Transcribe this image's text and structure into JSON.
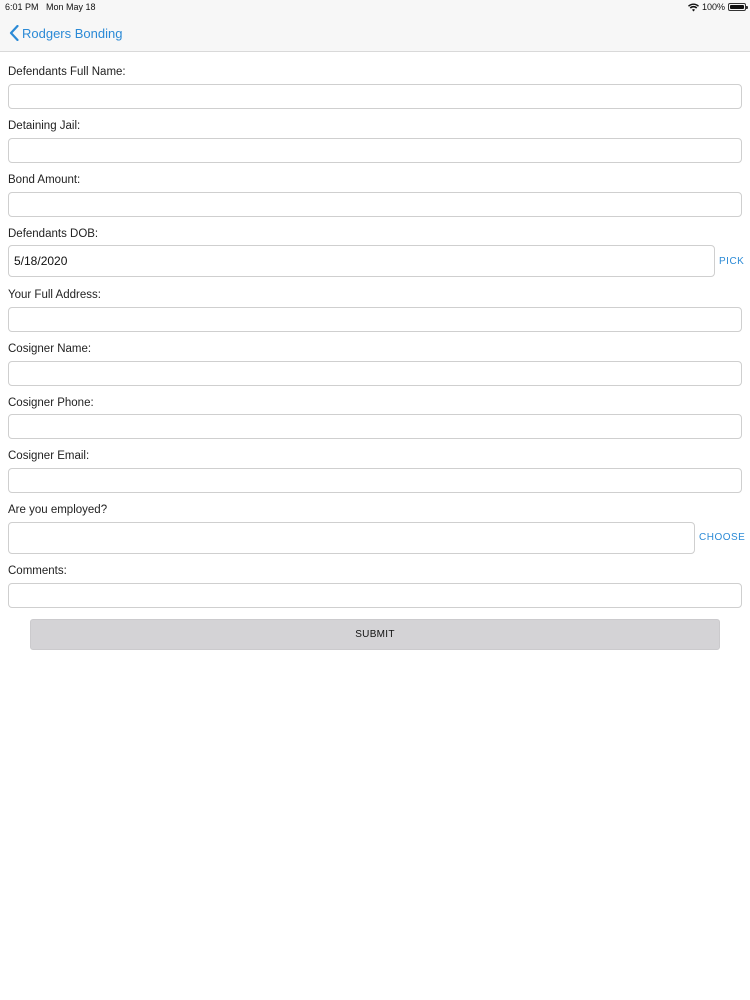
{
  "status": {
    "time": "6:01 PM",
    "date": "Mon May 18",
    "battery": "100%"
  },
  "nav": {
    "back_label": "Rodgers Bonding"
  },
  "form": {
    "full_name_label": "Defendants Full Name:",
    "full_name_value": "",
    "jail_label": "Detaining Jail:",
    "jail_value": "",
    "bond_label": "Bond Amount:",
    "bond_value": "",
    "dob_label": "Defendants DOB:",
    "dob_value": "5/18/2020",
    "dob_pick": "PICK",
    "address_label": "Your Full Address:",
    "address_value": "",
    "cosigner_name_label": "Cosigner Name:",
    "cosigner_name_value": "",
    "cosigner_phone_label": "Cosigner Phone:",
    "cosigner_phone_value": "",
    "cosigner_email_label": "Cosigner Email:",
    "cosigner_email_value": "",
    "employed_label": "Are you employed?",
    "employed_value": "",
    "employed_choose": "CHOOSE",
    "comments_label": "Comments:",
    "comments_value": "",
    "submit_label": "SUBMIT"
  },
  "colors": {
    "accent": "#2b8ad6",
    "submit_bg": "#d4d3d6"
  }
}
